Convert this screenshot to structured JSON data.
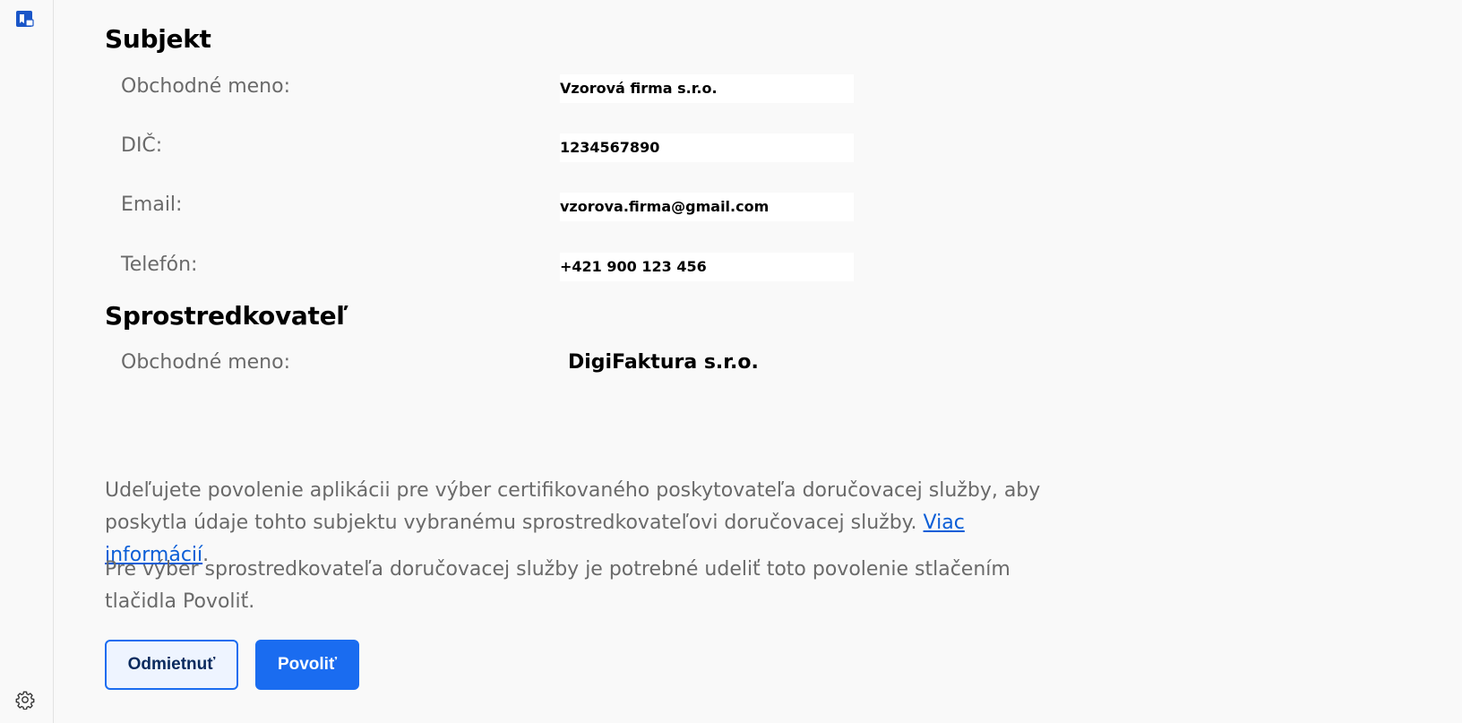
{
  "subject": {
    "heading": "Subjekt",
    "fields": [
      {
        "label": "Obchodné meno:",
        "value": "Vzorová firma s.r.o."
      },
      {
        "label": "DIČ:",
        "value": "1234567890"
      },
      {
        "label": "Email:",
        "value": "vzorova.firma@gmail.com"
      },
      {
        "label": "Telefón:",
        "value": "+421 900 123 456"
      }
    ]
  },
  "intermediary": {
    "heading": "Sprostredkovateľ",
    "fields": [
      {
        "label": "Obchodné meno:",
        "value": "DigiFaktura s.r.o."
      }
    ]
  },
  "consent": {
    "paragraph1_text": "Udeľujete povolenie aplikácii pre výber certifikovaného poskytovateľa doručovacej služby, aby poskytla údaje tohto subjektu vybranému sprostredkovateľovi doručovacej služby.",
    "paragraph1_link": "Viac informácií",
    "paragraph1_end": ".",
    "paragraph2_text": "Pre výber sprostredkovateľa doručovacej služby je potrebné udeliť toto povolenie stlačením tlačidla Povoliť."
  },
  "actions": {
    "decline_label": "Odmietnuť",
    "allow_label": "Povoliť"
  },
  "icons": {
    "logo": "app-logo-icon",
    "settings": "gear-icon"
  },
  "colors": {
    "accent": "#1a6cf0",
    "link": "#0b5ed7",
    "label_gray": "#6a6a6a"
  }
}
